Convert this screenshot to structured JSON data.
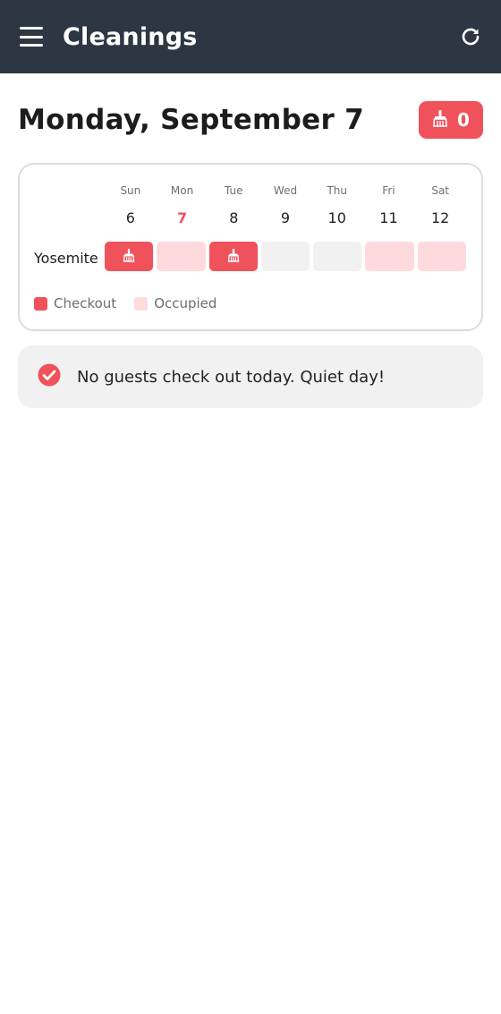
{
  "header": {
    "title": "Cleanings",
    "menu_icon": "hamburger-menu-icon",
    "refresh_icon": "refresh-icon"
  },
  "date_title": "Monday, September 7",
  "badge": {
    "icon": "broom-icon",
    "count": "0"
  },
  "calendar": {
    "day_names": [
      "Sun",
      "Mon",
      "Tue",
      "Wed",
      "Thu",
      "Fri",
      "Sat"
    ],
    "day_numbers": [
      "6",
      "7",
      "8",
      "9",
      "10",
      "11",
      "12"
    ],
    "today_index": 1,
    "property_name": "Yosemite",
    "cells": [
      "checkout",
      "occupied",
      "checkout",
      "empty",
      "empty",
      "occupied",
      "occupied"
    ],
    "legend": {
      "checkout": "Checkout",
      "occupied": "Occupied"
    }
  },
  "notice": {
    "icon": "check-circle-icon",
    "text": "No guests check out today. Quiet day!"
  },
  "colors": {
    "header_bg": "#2d3743",
    "accent": "#f0525c",
    "occupied": "#fedadc",
    "empty": "#f1f1f1"
  }
}
